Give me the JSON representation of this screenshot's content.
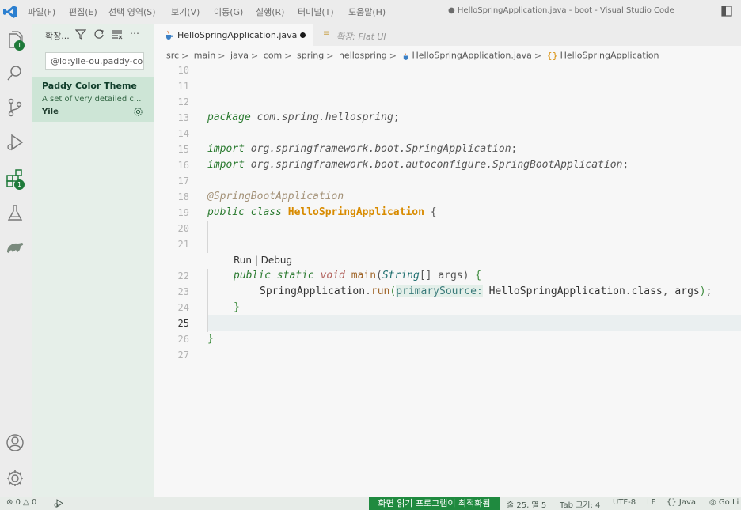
{
  "menu": [
    "파일(F)",
    "편집(E)",
    "선택 영역(S)",
    "보기(V)",
    "이동(G)",
    "실행(R)",
    "터미널(T)",
    "도움말(H)"
  ],
  "window_title": "● HelloSpringApplication.java - boot - Visual Studio Code",
  "activity_bar": {
    "explorer_badge": "1",
    "extensions_badge": "1"
  },
  "sidebar": {
    "title": "확장...",
    "search_value": "@id:yile-ou.paddy-col",
    "extension": {
      "name": "Paddy Color Theme",
      "description": "A set of very detailed c...",
      "author": "Yile"
    }
  },
  "tabs": {
    "active": "HelloSpringApplication.java",
    "preview": "확장: Flat UI"
  },
  "breadcrumb": [
    "src",
    "main",
    "java",
    "com",
    "spring",
    "hellospring",
    "HelloSpringApplication.java",
    "HelloSpringApplication"
  ],
  "editor": {
    "line_numbers": [
      "10",
      "11",
      "12",
      "13",
      "14",
      "15",
      "16",
      "17",
      "18",
      "19",
      "20",
      "21",
      "22",
      "23",
      "24",
      "25",
      "26",
      "27"
    ],
    "code": {
      "l13_kw": "package",
      "l13_pkg": "com.spring.hellospring",
      "l15_kw": "import",
      "l15_pkg": "org.springframework.boot.SpringApplication",
      "l16_kw": "import",
      "l16_pkg": "org.springframework.boot.autoconfigure.SpringBootApplication",
      "l18_ann": "@SpringBootApplication",
      "l19_kw": "public class",
      "l19_cls": "HelloSpringApplication",
      "codelens": "Run | Debug",
      "l22_kw": "public static",
      "l22_void": "void",
      "l22_meth": "main",
      "l22_type": "String",
      "l22_args": "args",
      "l23_cls": "SpringApplication",
      "l23_meth": "run",
      "l23_hint": "primarySource:",
      "l23_ref": "HelloSpringApplication",
      "l23_class": "class",
      "l23_args": "args"
    }
  },
  "statusbar": {
    "errors": "0",
    "warnings": "0",
    "highlight": "화면 읽기 프로그램이 최적화됨",
    "position": "줄 25, 열 5",
    "tab_size": "Tab 크기: 4",
    "encoding": "UTF-8",
    "eol": "LF",
    "language": "Java",
    "golive": "Go Li"
  }
}
